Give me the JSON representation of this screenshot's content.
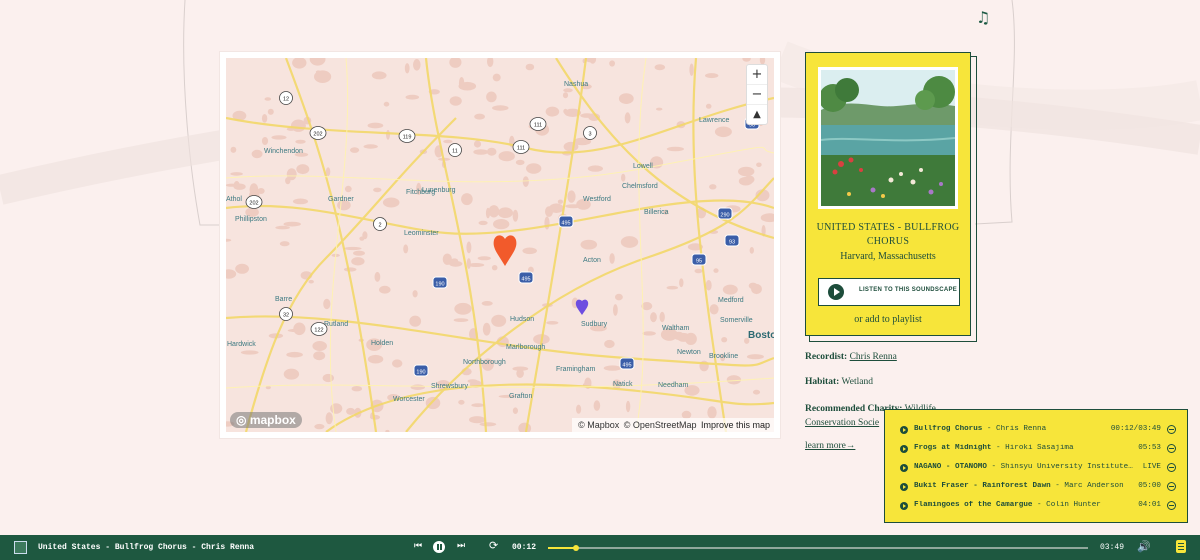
{
  "header": {
    "music_icon": "music-note-icon"
  },
  "map": {
    "provider_logo": "mapbox",
    "attribution": {
      "mapbox": "© Mapbox",
      "osm": "© OpenStreetMap",
      "improve": "Improve this map"
    },
    "controls": {
      "zoom_in": "+",
      "zoom_out": "−",
      "compass": "compass-icon"
    },
    "places": [
      "Nashua",
      "Lawrence",
      "Winchendon",
      "Lowell",
      "Chelmsford",
      "Westford",
      "Billerica",
      "Fitchburg",
      "Lunenburg",
      "Gardner",
      "Athol",
      "Phillipston",
      "Leominster",
      "Acton",
      "Barre",
      "Rutland",
      "Hudson",
      "Sudbury",
      "Medford",
      "Somerville",
      "Waltham",
      "Newton",
      "Brookline",
      "Bosto",
      "Hardwick",
      "Holden",
      "Northborough",
      "Marlborough",
      "Framingham",
      "Natick",
      "Needham",
      "Shrewsbury",
      "Worcester",
      "Grafton"
    ],
    "route_shields": [
      "12",
      "202",
      "119",
      "111",
      "3",
      "11",
      "111",
      "202",
      "2",
      "495",
      "93",
      "95",
      "190",
      "495",
      "32",
      "122",
      "190",
      "495",
      "290",
      "90"
    ],
    "markers": [
      {
        "name": "Bullfrog Chorus",
        "color": "#f25a2b",
        "type": "selected"
      },
      {
        "name": "soundscape",
        "color": "#6e4de0",
        "type": "other"
      }
    ]
  },
  "card": {
    "title": "UNITED STATES - BULLFROG CHORUS",
    "location": "Harvard, Massachusetts",
    "listen_label": "LISTEN TO THIS SOUNDSCAPE",
    "playlist_label": "or add to playlist"
  },
  "details": {
    "recordist_label": "Recordist:",
    "recordist": "Chris Renna",
    "habitat_label": "Habitat:",
    "habitat": "Wetland",
    "charity_label": "Recommended Charity:",
    "charity_line1": "Wildlife",
    "charity_line2": "Conservation Socie",
    "learn_more": "learn more→"
  },
  "queue": [
    {
      "title": "Bullfrog Chorus",
      "artist": " - Chris Renna",
      "time": "00:12/03:49"
    },
    {
      "title": "Frogs at Midnight",
      "artist": " - Hiroki Sasajima",
      "time": "05:53"
    },
    {
      "title": "NAGANO - OTANOMO",
      "artist": " - Shinsyu University Institute…",
      "time": "LIVE"
    },
    {
      "title": "Bukit Fraser - Rainforest Dawn",
      "artist": " - Marc Anderson",
      "time": "05:00"
    },
    {
      "title": "Flamingoes of the Camargue",
      "artist": " - Colin Hunter",
      "time": "04:01"
    }
  ],
  "player": {
    "now_playing": "United States - Bullfrog Chorus - Chris Renna",
    "current_time": "00:12",
    "total_time": "03:49",
    "progress": 0.052,
    "accent": "#f7e53a",
    "bar_color": "#1e5840"
  }
}
